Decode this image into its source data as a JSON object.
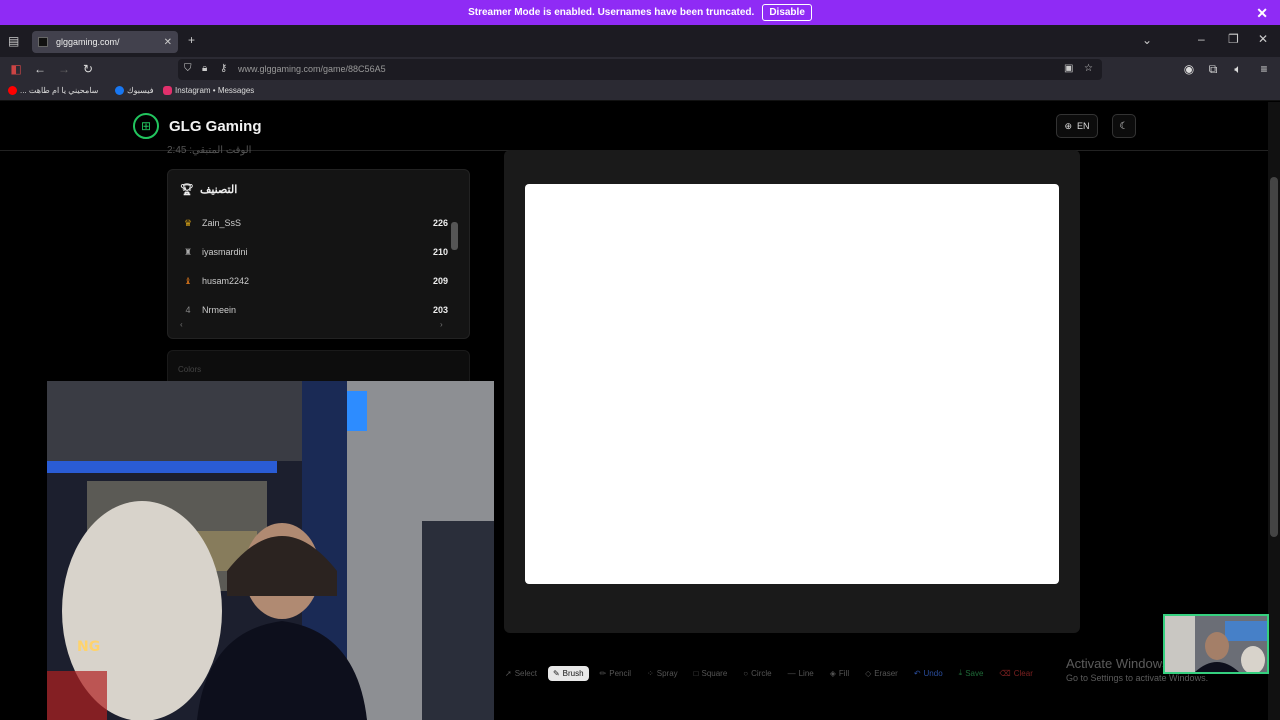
{
  "banner": {
    "message": "Streamer Mode is enabled. Usernames have been truncated.",
    "disable_label": "Disable"
  },
  "browser": {
    "tab_title": "glggaming.com/",
    "url": "www.glggaming.com/game/88C56A5",
    "bookmarks": [
      {
        "label": "... سامحيني يا ام طاهت",
        "color": "#ff0000"
      },
      {
        "label": "فيسبوك",
        "color": "#1877f2"
      },
      {
        "label": "Instagram • Messages",
        "color": "#e1306c"
      }
    ]
  },
  "site": {
    "brand": "GLG Gaming",
    "language": "EN",
    "faded_heading": "الوقت المتبقي: 2:45"
  },
  "ranking": {
    "title": "التصنيف",
    "players": [
      {
        "rank_icon": "crown-icon",
        "name": "Zain_SsS",
        "score": "226"
      },
      {
        "rank_icon": "trophy-icon",
        "name": "iyasmardini",
        "score": "210"
      },
      {
        "rank_icon": "medal-icon",
        "name": "husam2242",
        "score": "209"
      },
      {
        "rank_icon": "4",
        "name": "Nrmeein",
        "score": "203"
      }
    ]
  },
  "colors_label": "Colors",
  "toolbar": {
    "tools": [
      {
        "label": "Select",
        "icon": "cursor-icon"
      },
      {
        "label": "Brush",
        "icon": "brush-icon",
        "active": true
      },
      {
        "label": "Pencil",
        "icon": "pencil-icon"
      },
      {
        "label": "Spray",
        "icon": "spray-icon"
      },
      {
        "label": "Square",
        "icon": "square-icon"
      },
      {
        "label": "Circle",
        "icon": "circle-icon"
      },
      {
        "label": "Line",
        "icon": "line-icon"
      },
      {
        "label": "Fill",
        "icon": "fill-icon"
      },
      {
        "label": "Eraser",
        "icon": "eraser-icon"
      }
    ],
    "undo_label": "Undo",
    "save_label": "Save",
    "clear_label": "Clear"
  },
  "watermark": {
    "title": "Activate Windows",
    "subtitle": "Go to Settings to activate Windows."
  },
  "colors": {
    "banner": "#8f2bf5",
    "brand_green": "#22c55e",
    "minicam_border": "#35d07f"
  }
}
